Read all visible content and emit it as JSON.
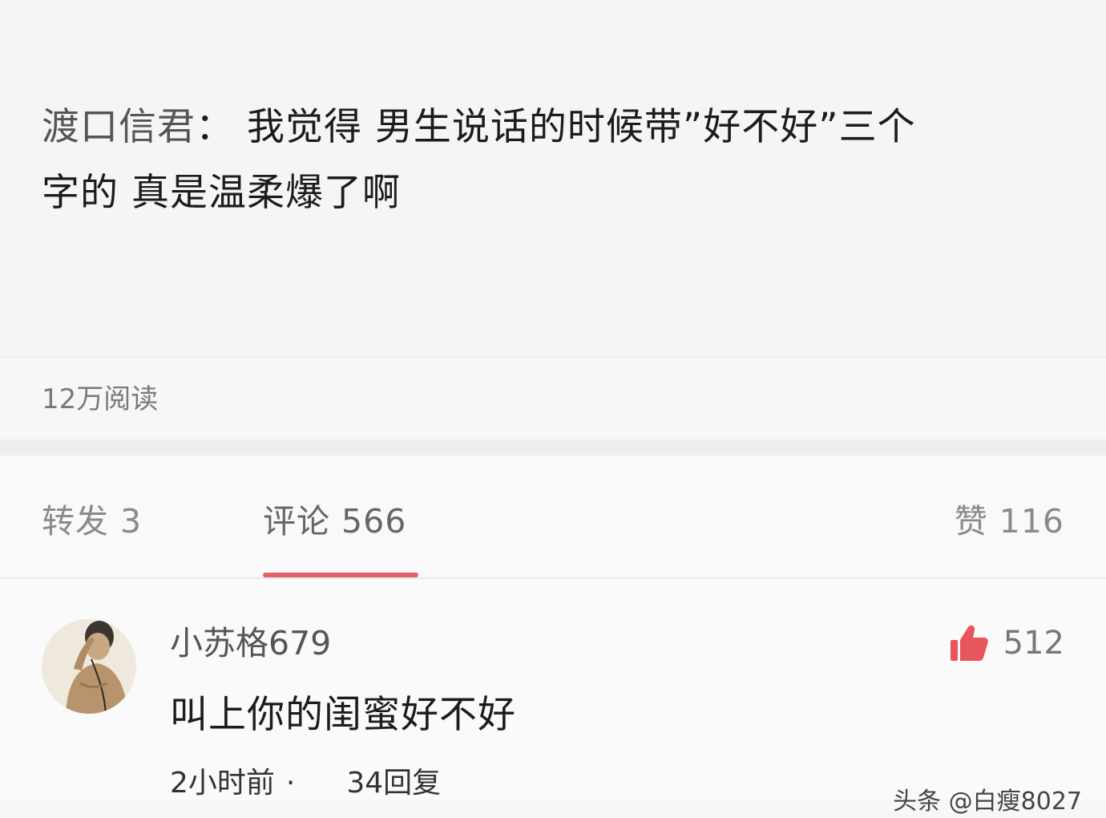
{
  "post": {
    "author": "渡口信君",
    "separator": "：",
    "text_line1": "我觉得 男生说话的时候带”好不好”三个",
    "text_line2": "字的 真是温柔爆了啊",
    "reads": "12万阅读"
  },
  "tabs": {
    "forward": "转发 3",
    "comments": "评论 566",
    "likes": "赞 116",
    "active_color": "#e06266"
  },
  "comment": {
    "username": "小苏格679",
    "likes": "512",
    "text": "叫上你的闺蜜好不好",
    "time": "2小时前",
    "dot": "·",
    "replies": "34回复",
    "like_icon": "thumbs-up-icon",
    "like_color": "#e8555a"
  },
  "watermark": "头条 @白瘦8027"
}
